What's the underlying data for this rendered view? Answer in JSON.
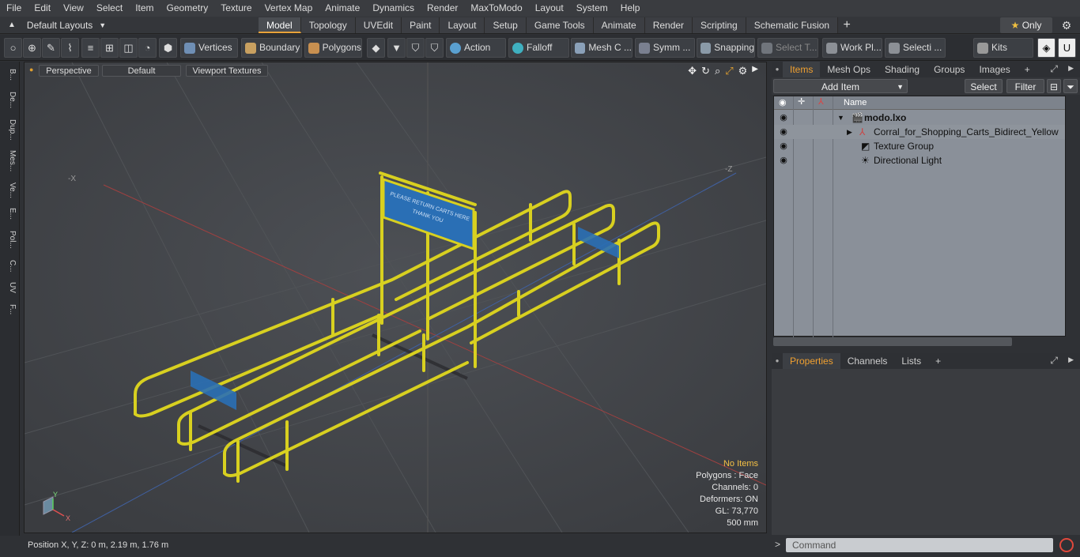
{
  "menu": [
    "File",
    "Edit",
    "View",
    "Select",
    "Item",
    "Geometry",
    "Texture",
    "Vertex Map",
    "Animate",
    "Dynamics",
    "Render",
    "MaxToModo",
    "Layout",
    "System",
    "Help"
  ],
  "layout": {
    "label": "Default Layouts"
  },
  "tabs": [
    "Model",
    "Topology",
    "UVEdit",
    "Paint",
    "Layout",
    "Setup",
    "Game Tools",
    "Animate",
    "Render",
    "Scripting",
    "Schematic Fusion"
  ],
  "only_label": "Only",
  "toolbar": {
    "vertices": "Vertices",
    "boundary": "Boundary",
    "polygons": "Polygons",
    "action": "Action",
    "falloff": "Falloff",
    "mesh": "Mesh C ...",
    "symm": "Symm ...",
    "snapping": "Snapping",
    "select_t": "Select T...",
    "workpl": "Work Pl...",
    "selecti": "Selecti ...",
    "kits": "Kits"
  },
  "left_tabs": [
    "B...",
    "De...",
    "Dup...",
    "Mes...",
    "Ve...",
    "E...",
    "Pol...",
    "C...",
    "UV",
    "F..."
  ],
  "viewport": {
    "perspective": "Perspective",
    "default": "Default",
    "textures": "Viewport Textures",
    "axis_x_neg": "-X",
    "axis_z_neg": "-Z",
    "sign_line1": "PLEASE RETURN CARTS HERE",
    "sign_line2": "THANK YOU",
    "stats": {
      "no_items": "No Items",
      "polygons": "Polygons : Face",
      "channels": "Channels: 0",
      "deformers": "Deformers: ON",
      "gl": "GL: 73,770",
      "scale": "500 mm"
    }
  },
  "status": {
    "position": "Position X, Y, Z:   0 m, 2.19 m, 1.76 m"
  },
  "right_panel": {
    "tabs": [
      "Items",
      "Mesh Ops",
      "Shading",
      "Groups",
      "Images"
    ],
    "add_item": "Add Item",
    "select": "Select",
    "filter": "Filter",
    "name_col": "Name",
    "items": [
      {
        "label": "modo.lxo",
        "bold": true
      },
      {
        "label": "Corral_for_Shopping_Carts_Bidirect_Yellow"
      },
      {
        "label": "Texture Group"
      },
      {
        "label": "Directional Light"
      }
    ]
  },
  "props_tabs": [
    "Properties",
    "Channels",
    "Lists"
  ],
  "command_placeholder": "Command",
  "colors": {
    "accent": "#f0a030",
    "rail": "#e8e030",
    "sign": "#2a6fb5"
  }
}
